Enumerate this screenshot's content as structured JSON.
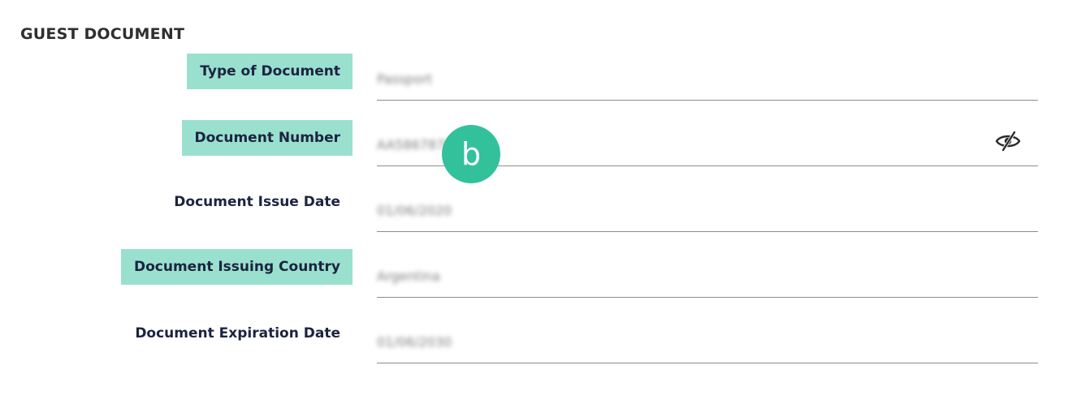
{
  "section": {
    "title": "GUEST DOCUMENT"
  },
  "fields": [
    {
      "label": "Type of Document",
      "value": "Passport",
      "highlighted": true
    },
    {
      "label": "Document Number",
      "value": "AA5867878",
      "highlighted": true
    },
    {
      "label": "Document Issue Date",
      "value": "01/06/2020",
      "highlighted": false
    },
    {
      "label": "Document Issuing Country",
      "value": "Argentina",
      "highlighted": true
    },
    {
      "label": "Document Expiration Date",
      "value": "01/06/2030",
      "highlighted": false
    }
  ],
  "badge": {
    "text": "b",
    "color": "#33c19b"
  },
  "colors": {
    "highlight": "#9ae0cf",
    "label_text": "#1c2340",
    "underline": "#8c8c8c"
  },
  "icons": {
    "visibility_toggle": "eye-slash-icon"
  }
}
